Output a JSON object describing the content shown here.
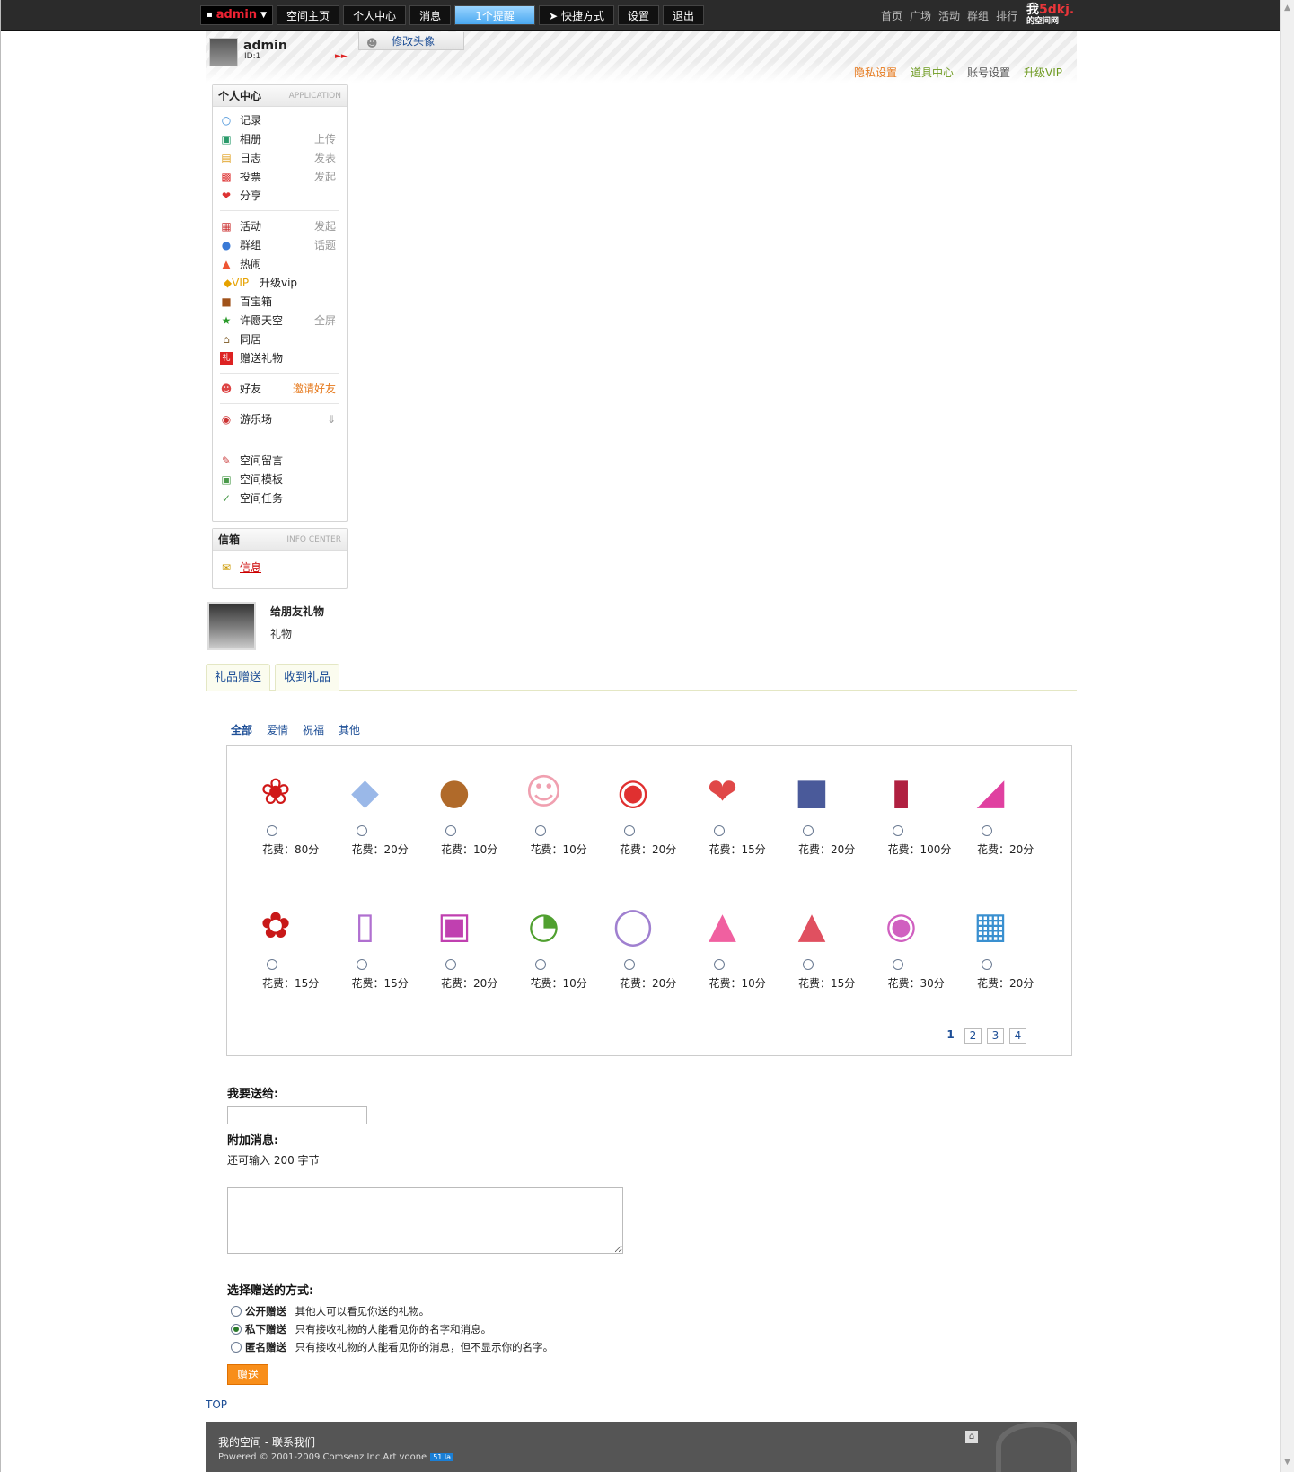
{
  "topbar": {
    "user": "admin",
    "nav": [
      "空间主页",
      "个人中心",
      "消息"
    ],
    "remind": "1个提醒",
    "shortcut": "快捷方式",
    "settings": "设置",
    "logout": "退出",
    "right_links": [
      "首页",
      "广场",
      "活动",
      "群组",
      "排行"
    ],
    "logo_main": "我",
    "logo_brand": "5dkj.",
    "logo_sub": "的空间网"
  },
  "header": {
    "username": "admin",
    "uid": "ID:1",
    "edit_avatar": "修改头像",
    "links": [
      {
        "label": "隐私设置",
        "color": "#e6791c"
      },
      {
        "label": "道具中心",
        "color": "#6d9a1f"
      },
      {
        "label": "账号设置",
        "color": "#555555"
      },
      {
        "label": "升级VIP",
        "color": "#6d9a1f"
      }
    ]
  },
  "app_box": {
    "title": "个人中心",
    "subtitle": "APPLICATION",
    "group1": [
      {
        "label": "记录",
        "icon": "speech-bubble-icon",
        "extra": ""
      },
      {
        "label": "相册",
        "icon": "album-icon",
        "extra": "上传"
      },
      {
        "label": "日志",
        "icon": "blog-icon",
        "extra": "发表"
      },
      {
        "label": "投票",
        "icon": "poll-icon",
        "extra": "发起"
      },
      {
        "label": "分享",
        "icon": "share-icon",
        "extra": ""
      }
    ],
    "group2": [
      {
        "label": "活动",
        "icon": "calendar-icon",
        "extra": "发起"
      },
      {
        "label": "群组",
        "icon": "group-icon",
        "extra": "话题"
      },
      {
        "label": "热闹",
        "icon": "fire-icon",
        "extra": ""
      },
      {
        "label": "升级vip",
        "icon": "vip-icon",
        "extra": ""
      },
      {
        "label": "百宝箱",
        "icon": "treasure-icon",
        "extra": ""
      },
      {
        "label": "许愿天空",
        "icon": "star-icon",
        "extra": "全屏"
      },
      {
        "label": "同居",
        "icon": "house-icon",
        "extra": ""
      },
      {
        "label": "赠送礼物",
        "icon": "gift-icon",
        "extra": ""
      }
    ],
    "friends": {
      "label": "好友",
      "extra": "邀请好友"
    },
    "playground": {
      "label": "游乐场"
    },
    "group3": [
      {
        "label": "空间留言",
        "icon": "guestbook-icon"
      },
      {
        "label": "空间模板",
        "icon": "template-icon"
      },
      {
        "label": "空间任务",
        "icon": "task-icon"
      }
    ]
  },
  "mail_box": {
    "title": "信箱",
    "subtitle": "INFO CENTER",
    "item": "信息"
  },
  "page": {
    "title": "给朋友礼物",
    "subtitle": "礼物",
    "tabs": [
      "礼品赠送",
      "收到礼品"
    ],
    "categories": [
      "全部",
      "爱情",
      "祝福",
      "其他"
    ]
  },
  "gifts": [
    {
      "price": "花费：80分",
      "icon": "rose-icon"
    },
    {
      "price": "花费：20分",
      "icon": "diamond-icon"
    },
    {
      "price": "花费：10分",
      "icon": "teddy-bear-icon"
    },
    {
      "price": "花费：10分",
      "icon": "cupid-icon"
    },
    {
      "price": "花费：20分",
      "icon": "lollipop-icon"
    },
    {
      "price": "花费：15分",
      "icon": "love-card-icon"
    },
    {
      "price": "花费：20分",
      "icon": "clothes-icon"
    },
    {
      "price": "花费：100分",
      "icon": "lipstick-icon"
    },
    {
      "price": "花费：20分",
      "icon": "high-heel-icon"
    },
    {
      "price": "花费：15分",
      "icon": "bouquet-icon"
    },
    {
      "price": "花费：15分",
      "icon": "popsicle-icon"
    },
    {
      "price": "花费：20分",
      "icon": "perfume-icon"
    },
    {
      "price": "花费：10分",
      "icon": "lovebirds-icon"
    },
    {
      "price": "花费：20分",
      "icon": "ring-icon"
    },
    {
      "price": "花费：10分",
      "icon": "jelly-icon"
    },
    {
      "price": "花费：15分",
      "icon": "hat-icon"
    },
    {
      "price": "花费：30分",
      "icon": "slippers-icon"
    },
    {
      "price": "花费：20分",
      "icon": "gift-box-icon"
    }
  ],
  "pager": [
    "1",
    "2",
    "3",
    "4"
  ],
  "form": {
    "to_label": "我要送给:",
    "msg_label": "附加消息:",
    "remain": "还可输入  200 字节",
    "method_label": "选择赠送的方式:",
    "options": [
      {
        "title": "公开赠送",
        "desc": "其他人可以看见你送的礼物。",
        "checked": false
      },
      {
        "title": "私下赠送",
        "desc": "只有接收礼物的人能看见你的名字和消息。",
        "checked": true
      },
      {
        "title": "匿名赠送",
        "desc": "只有接收礼物的人能看见你的消息，但不显示你的名字。",
        "checked": false
      }
    ],
    "send": "赠送"
  },
  "top_link": "TOP",
  "footer": {
    "line1": "我的空间  -  联系我们",
    "line2": "Powered © 2001-2009 Comsenz Inc.Art voone",
    "badge": "51.la"
  }
}
